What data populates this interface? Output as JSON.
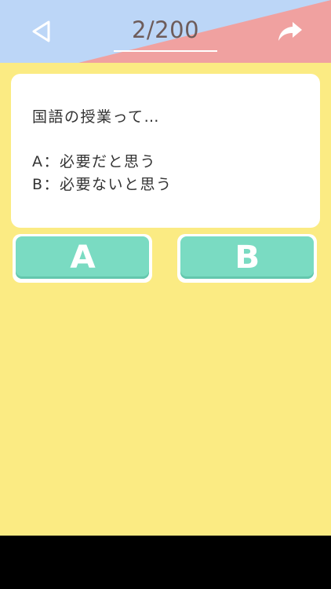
{
  "header": {
    "counter": "2/200",
    "back_icon": "back-triangle-icon",
    "share_icon": "share-arrow-icon",
    "colors": {
      "left": "#bcd6f7",
      "right": "#f0a1a0"
    }
  },
  "question": {
    "text": "国語の授業って…",
    "option_a": "A：必要だと思う",
    "option_b": "B：必要ないと思う"
  },
  "answers": {
    "a_label": "A",
    "b_label": "B",
    "color": "#7adbc2"
  },
  "background": "#fbeb83"
}
